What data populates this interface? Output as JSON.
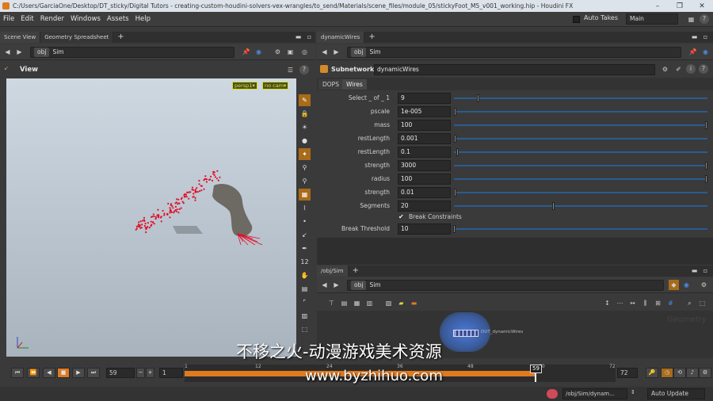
{
  "window": {
    "title": "C:/Users/GarciaOne/Desktop/DT_sticky/Digital Tutors - creating-custom-houdini-solvers-vex-wrangles/to_send/Materials/scene_files/module_05/stickyFoot_M5_v001_working.hip - Houdini FX",
    "controls": [
      "–",
      "❐",
      "✕"
    ]
  },
  "menu": {
    "items": [
      "File",
      "Edit",
      "Render",
      "Windows",
      "Assets",
      "Help"
    ],
    "auto_takes": "Auto Takes",
    "desktop": "Main"
  },
  "left": {
    "tabs": [
      "Scene View",
      "Geometry Spreadsheet"
    ],
    "path": {
      "root": "obj",
      "node": "Sim"
    },
    "title": "View",
    "persp": "persp1▾",
    "cam": "no cam▾"
  },
  "right": {
    "tab": "dynamicWires",
    "path": {
      "root": "obj",
      "node": "Sim"
    },
    "node_type": "Subnetwork",
    "node_name": "dynamicWires",
    "subtabs": [
      "DOPS",
      "Wires"
    ],
    "params": [
      {
        "label": "Select _ of _ 1",
        "value": "9",
        "knob": 0.09
      },
      {
        "label": "pscale",
        "value": "1e-005",
        "knob": 0.0
      },
      {
        "label": "mass",
        "value": "100",
        "knob": 1.0
      },
      {
        "label": "restLength",
        "value": "0.001",
        "knob": 0.0
      },
      {
        "label": "restLength",
        "value": "0.1",
        "knob": 0.01
      },
      {
        "label": "strength",
        "value": "3000",
        "knob": 1.0
      },
      {
        "label": "radius",
        "value": "100",
        "knob": 1.0
      },
      {
        "label": "strength",
        "value": "0.01",
        "knob": 0.0
      },
      {
        "label": "Segments",
        "value": "20",
        "knob": 0.39
      }
    ],
    "break_constraints": "Break Constraints",
    "break_threshold": {
      "label": "Break Threshold",
      "value": "10"
    }
  },
  "network": {
    "tab": "/obj/Sim",
    "path": {
      "root": "obj",
      "node": "Sim"
    },
    "node_label": "OUT_dynamicWires",
    "ghost": "Geometry"
  },
  "timeline": {
    "current_frame": "59",
    "start": "1",
    "end": "72",
    "ticks": [
      "1",
      "12",
      "24",
      "36",
      "48",
      "60",
      "72"
    ],
    "playhead": "59",
    "playhead_fraction": 0.813
  },
  "status": {
    "path": "/obj/Sim/dynam...",
    "update": "Auto Update"
  },
  "watermark": {
    "line1": "不移之火-动漫游戏美术资源",
    "line2": "www.byzhihuo.com"
  },
  "colors": {
    "accent": "#e07a1f",
    "slider": "#2a5c92",
    "sim_points": "#e0102a"
  }
}
